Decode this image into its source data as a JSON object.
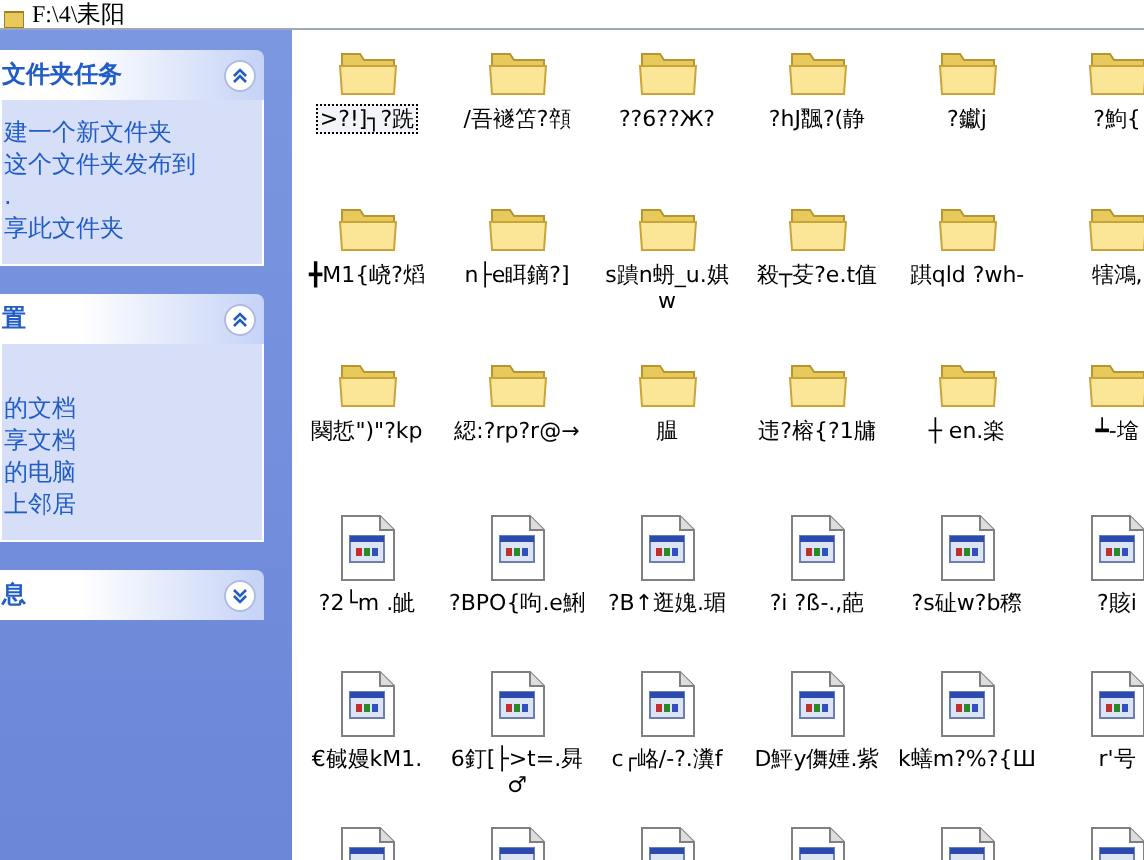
{
  "address_bar": {
    "path": "F:\\4\\耒阳"
  },
  "task_panels": [
    {
      "title": "文件夹任务",
      "expanded": true,
      "items": [
        "建一个新文件夹",
        "这个文件夹发布到",
        ".",
        "享此文件夹"
      ]
    },
    {
      "title": "置",
      "expanded": true,
      "items": [
        "的文档",
        "享文档",
        "的电脑",
        "上邻居"
      ]
    },
    {
      "title": "息",
      "expanded": false
    }
  ],
  "files": [
    {
      "kind": "folder",
      "name": ">?!]┐?跣",
      "selected": true
    },
    {
      "kind": "folder",
      "name": "/吾襚笘?顇",
      "selected": false
    },
    {
      "kind": "folder",
      "name": "??6??Ж?",
      "selected": false
    },
    {
      "kind": "folder",
      "name": "?hJ飁?(静",
      "selected": false
    },
    {
      "kind": "folder",
      "name": "?钀j",
      "selected": false
    },
    {
      "kind": "folder",
      "name": "?鮈{",
      "selected": false
    },
    {
      "kind": "folder",
      "name": "╋M1{峣?熖",
      "selected": false
    },
    {
      "kind": "folder",
      "name": "n├e眲鏑?]",
      "selected": false
    },
    {
      "kind": "folder",
      "name": "s蹪n蚒_u.娸 w",
      "selected": false
    },
    {
      "kind": "folder",
      "name": "殺┬芟?e.t值",
      "selected": false
    },
    {
      "kind": "folder",
      "name": "踑qld ?wh-",
      "selected": false
    },
    {
      "kind": "folder",
      "name": "犗鴻,",
      "selected": false
    },
    {
      "kind": "folder",
      "name": "闋悊\")\"?kp",
      "selected": false
    },
    {
      "kind": "folder",
      "name": "綛:?rp?r@→",
      "selected": false
    },
    {
      "kind": "folder",
      "name": "腽",
      "selected": false
    },
    {
      "kind": "folder",
      "name": "违?榕{?1牗",
      "selected": false
    },
    {
      "kind": "folder",
      "name": "┼ en.楽",
      "selected": false
    },
    {
      "kind": "folder",
      "name": "┷-墖",
      "selected": false
    },
    {
      "kind": "file",
      "name": "?2└m .皉",
      "selected": false
    },
    {
      "kind": "file",
      "name": "?BPO{呴.e鯏",
      "selected": false
    },
    {
      "kind": "file",
      "name": "?B↑逛媿.瑂",
      "selected": false
    },
    {
      "kind": "file",
      "name": "?i ?ß-.,葩",
      "selected": false
    },
    {
      "kind": "file",
      "name": "?s砋w?b穄",
      "selected": false
    },
    {
      "kind": "file",
      "name": "?賅i",
      "selected": false
    },
    {
      "kind": "file",
      "name": "€戫嫚kM1.",
      "selected": false
    },
    {
      "kind": "file",
      "name": "6釘[├>t=.曻 ♂",
      "selected": false
    },
    {
      "kind": "file",
      "name": "c┌峈/-?.瀵f",
      "selected": false
    },
    {
      "kind": "file",
      "name": "D鮃y儛娷.紫",
      "selected": false
    },
    {
      "kind": "file",
      "name": "k蟮m?%?{Ш",
      "selected": false
    },
    {
      "kind": "file",
      "name": "r'号",
      "selected": false
    },
    {
      "kind": "file",
      "selected": false
    },
    {
      "kind": "file",
      "selected": false
    },
    {
      "kind": "file",
      "selected": false
    },
    {
      "kind": "file",
      "selected": false
    },
    {
      "kind": "file",
      "selected": false
    },
    {
      "kind": "file",
      "selected": false
    }
  ]
}
